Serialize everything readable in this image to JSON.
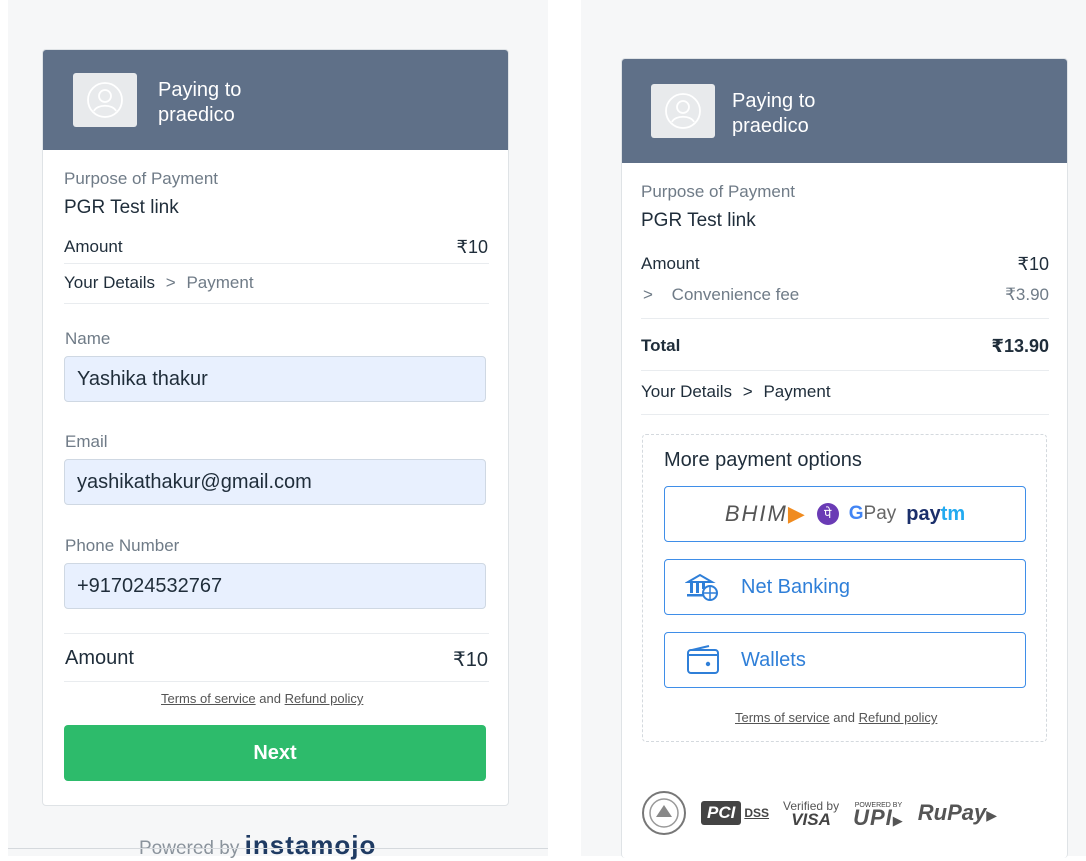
{
  "left": {
    "header": {
      "paying_line1": "Paying to",
      "paying_line2": "praedico"
    },
    "purpose_label": "Purpose of Payment",
    "purpose_value": "PGR Test link",
    "amount_label": "Amount",
    "amount_value": "₹10",
    "breadcrumb": {
      "step1": "Your Details",
      "sep": ">",
      "step2": "Payment"
    },
    "form": {
      "name_label": "Name",
      "name_value": "Yashika thakur",
      "email_label": "Email",
      "email_value": "yashikathakur@gmail.com",
      "phone_label": "Phone Number",
      "phone_value": "+917024532767"
    },
    "total_label": "Amount",
    "total_value": "₹10",
    "terms": {
      "tos": "Terms of service",
      "and": "and",
      "refund": "Refund policy"
    },
    "next_label": "Next",
    "powered_by": "Powered by",
    "brand": "instamojo"
  },
  "right": {
    "header": {
      "paying_line1": "Paying to",
      "paying_line2": "praedico"
    },
    "purpose_label": "Purpose of Payment",
    "purpose_value": "PGR Test link",
    "amount_label": "Amount",
    "amount_value": "₹10",
    "fee_chevron": ">",
    "fee_label": "Convenience fee",
    "fee_value": "₹3.90",
    "total_label": "Total",
    "total_value": "₹13.90",
    "breadcrumb": {
      "step1": "Your Details",
      "sep": ">",
      "step2": "Payment"
    },
    "more_options_title": "More payment options",
    "upi_brands": {
      "bhim": "BHIM",
      "gpay_g": "G",
      "gpay": "Pay",
      "paytm_pay": "pay",
      "paytm_tm": "tm"
    },
    "net_banking_label": "Net Banking",
    "wallets_label": "Wallets",
    "terms": {
      "tos": "Terms of service",
      "and": "and",
      "refund": "Refund policy"
    },
    "badges": {
      "pci": "PCI",
      "dss": "DSS",
      "verified_by": "Verified by",
      "visa": "VISA",
      "powered_by": "POWERED BY",
      "upi": "UPI",
      "rupay": "RuPay"
    }
  },
  "colors": {
    "header": "#5f7088",
    "next": "#2dbb6b",
    "link_blue": "#2f7fd8",
    "input_bg": "#e8f0fe"
  }
}
